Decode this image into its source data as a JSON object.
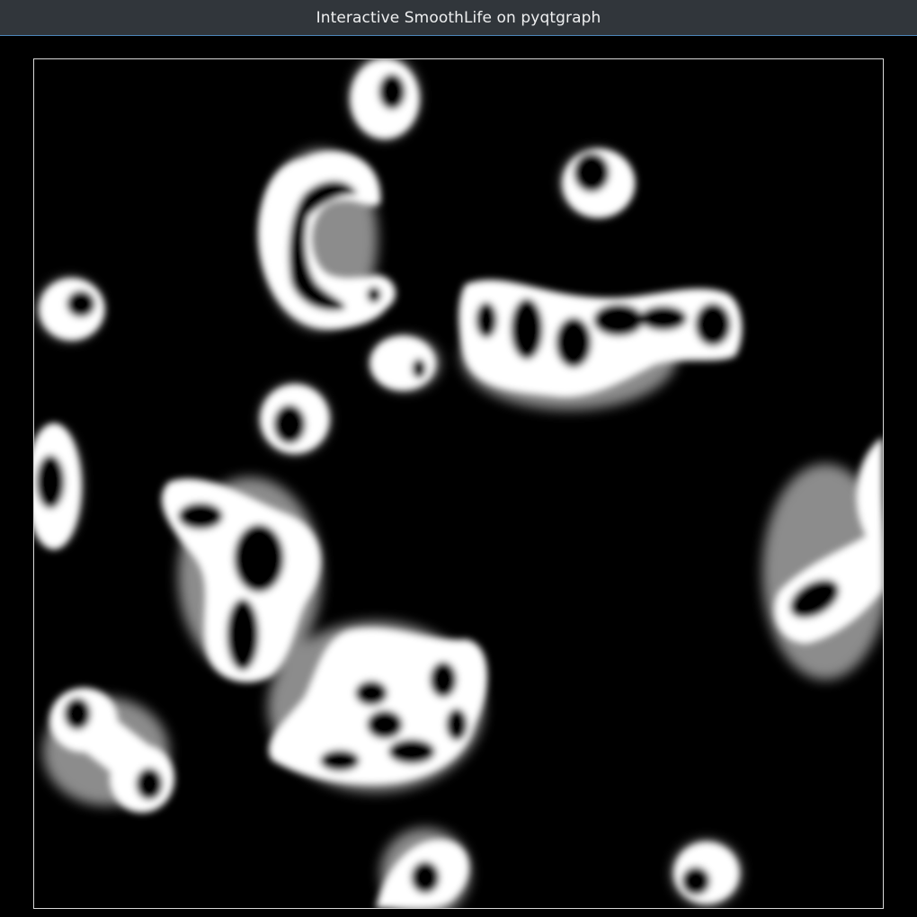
{
  "window": {
    "title": "Interactive SmoothLife on pyqtgraph"
  },
  "colors": {
    "titlebar_bg": "#31363b",
    "titlebar_text": "#eff0f1",
    "titlebar_accent": "#4d86b8",
    "plot_bg": "#000000",
    "cell_alive": "#ffffff",
    "viewbox_border": "#d8d8d8"
  },
  "simulation": {
    "colormap": "grayscale"
  }
}
